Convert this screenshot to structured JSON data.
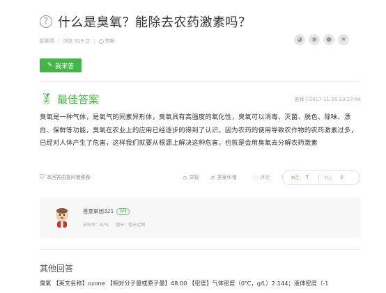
{
  "question": {
    "title": "什么是臭氧？能除去农药激素吗？",
    "asker": "起紫晴",
    "views": "浏览 919 次",
    "report": "举报"
  },
  "share_icons": [
    "wechat-icon",
    "weibo-icon",
    "qq-icon",
    "favorite-icon"
  ],
  "answer_button": {
    "label": "我来答"
  },
  "best_answer": {
    "heading": "最佳答案",
    "timestamp": "推荐于2017-11-26 13:27:44",
    "text": "臭氧是一种气体，是氧气的同素异形体，臭氧具有高强度的氧化性，臭氧可以消毒、灭菌、脱色、除味、漂白、保鲜等功能，臭氧在农业上的应用已经逐步的得到了认识，因为农药的使用导致农作物的农药激素过多，已经对人体产生了危害，这样我们就要从根源上解决这种危害，也就是会用臭氧去分解农药激素",
    "recommend_note": "本回答由提问者推荐",
    "actions": {
      "report": "举报",
      "answer_label": "答案纠错",
      "comment": "评论"
    },
    "votes": {
      "up": "7",
      "down": "0"
    }
  },
  "answerer": {
    "name": "首夏軍团321",
    "level": "LV4",
    "adoption_rate": "采纳率：87%",
    "specialty": "擅长：暂未定制"
  },
  "other_answers": {
    "heading": "其他回答",
    "text": "臭氧 【英文名称】ozone 【相对分子量或原子量】48.00 【密度】气体密度（0℃，g/L）2.144；液体密度（-1"
  }
}
